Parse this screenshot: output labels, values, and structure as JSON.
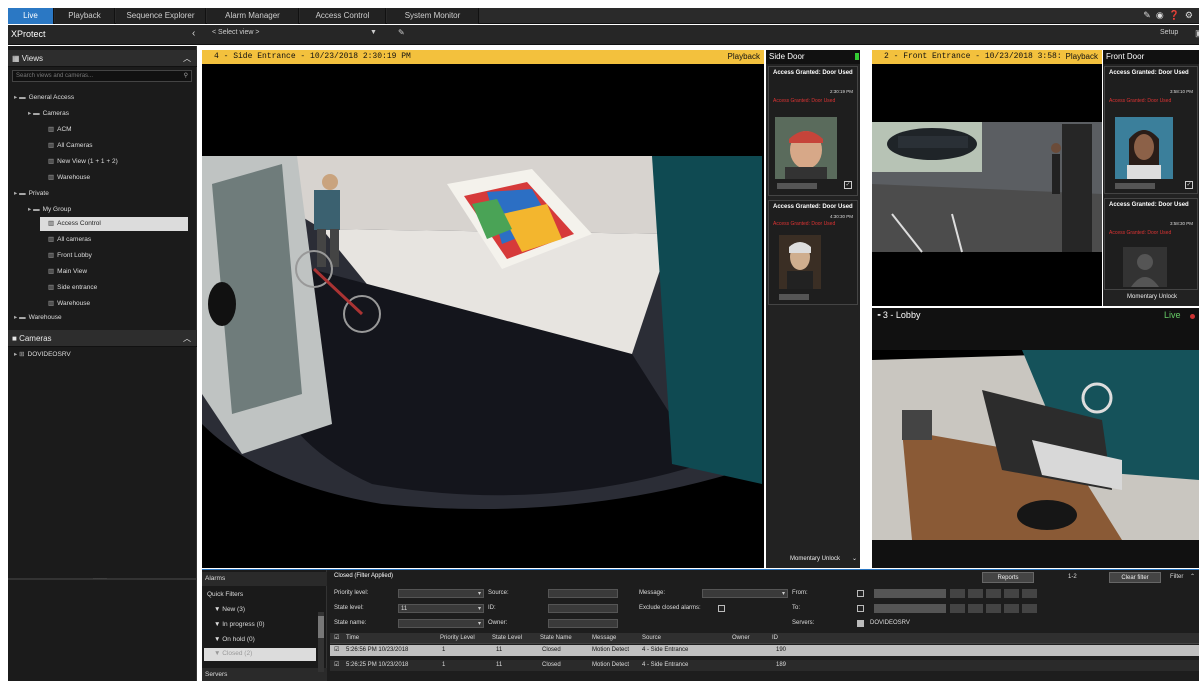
{
  "tabs": [
    "Live",
    "Playback",
    "Sequence Explorer",
    "Alarm Manager",
    "Access Control",
    "System Monitor"
  ],
  "top_icons": [
    "wrench-icon",
    "eye-icon",
    "help-icon",
    "gear-icon"
  ],
  "app_title": "XProtect",
  "select_view": "< Select view >",
  "setup_label": "Setup",
  "sidebar": {
    "views_label": "Views",
    "search_placeholder": "Search views and cameras...",
    "tree": [
      "General Access",
      "Cameras",
      "ACM",
      "All Cameras",
      "New View (1 + 1 + 2)",
      "Warehouse",
      "Private",
      "My Group",
      "Access Control",
      "All cameras",
      "Front Lobby",
      "Main View",
      "Side entrance",
      "Warehouse",
      "Warehouse"
    ],
    "cameras_label": "Cameras",
    "server": "DOVIDEOSRV"
  },
  "views": {
    "main": {
      "title": "4 - Side Entrance - 10/23/2018 2:30:19 PM",
      "mode": "Playback"
    },
    "side_door": {
      "title": "Side Door",
      "events": [
        {
          "event": "Access Granted: Door Used",
          "time": "2:30:19 PM",
          "detail": "Access Granted: Door Used"
        },
        {
          "event": "Access Granted: Door Used",
          "time": "4:30:30 PM",
          "detail": "Access Granted: Door Used"
        }
      ],
      "unlock": "Momentary Unlock"
    },
    "front": {
      "title": "2 - Front Entrance - 10/23/2018 3:58:",
      "mode": "Playback"
    },
    "front_door": {
      "title": "Front Door",
      "events": [
        {
          "event": "Access Granted: Door Used",
          "time": "3:58:10 PM",
          "detail": "Access Granted: Door Used"
        },
        {
          "event": "Access Granted: Door Used",
          "time": "3:58:30 PM",
          "detail": "Access Granted: Door Used"
        }
      ],
      "unlock": "Momentary Unlock"
    },
    "lobby": {
      "title": "3 - Lobby",
      "mode": "Live"
    }
  },
  "alarms": {
    "header": "Alarms",
    "quick_filters": "Quick Filters",
    "filters": [
      "New (3)",
      "In progress (0)",
      "On hold (0)",
      "Closed (2)"
    ],
    "servers_label": "Servers",
    "filter_title": "Closed (Filter Applied)",
    "reports_btn": "Reports",
    "page": "1-2",
    "clear_filter": "Clear filter",
    "filter_label": "Filter",
    "labels": {
      "priority": "Priority level:",
      "state_level": "State level:",
      "state_name": "State name:",
      "source": "Source:",
      "id": "ID:",
      "owner": "Owner:",
      "message": "Message:",
      "exclude": "Exclude closed alarms:",
      "from": "From:",
      "to": "To:",
      "servers": "Servers:"
    },
    "state_level_value": "11",
    "server_value": "DOVIDEOSRV",
    "columns": [
      "Time",
      "Priority Level",
      "State Level",
      "State Name",
      "Message",
      "Source",
      "Owner",
      "ID"
    ],
    "rows": [
      [
        "5:26:56 PM 10/23/2018",
        "1",
        "11",
        "Closed",
        "Motion Detect",
        "4 - Side Entrance",
        "",
        "190"
      ],
      [
        "5:26:25 PM 10/23/2018",
        "1",
        "11",
        "Closed",
        "Motion Detect",
        "4 - Side Entrance",
        "",
        "189"
      ]
    ]
  },
  "colors": {
    "accent": "#2b78c4",
    "title_bar": "#f3c13d",
    "live": "#66cc66",
    "alert": "#dd3333"
  }
}
